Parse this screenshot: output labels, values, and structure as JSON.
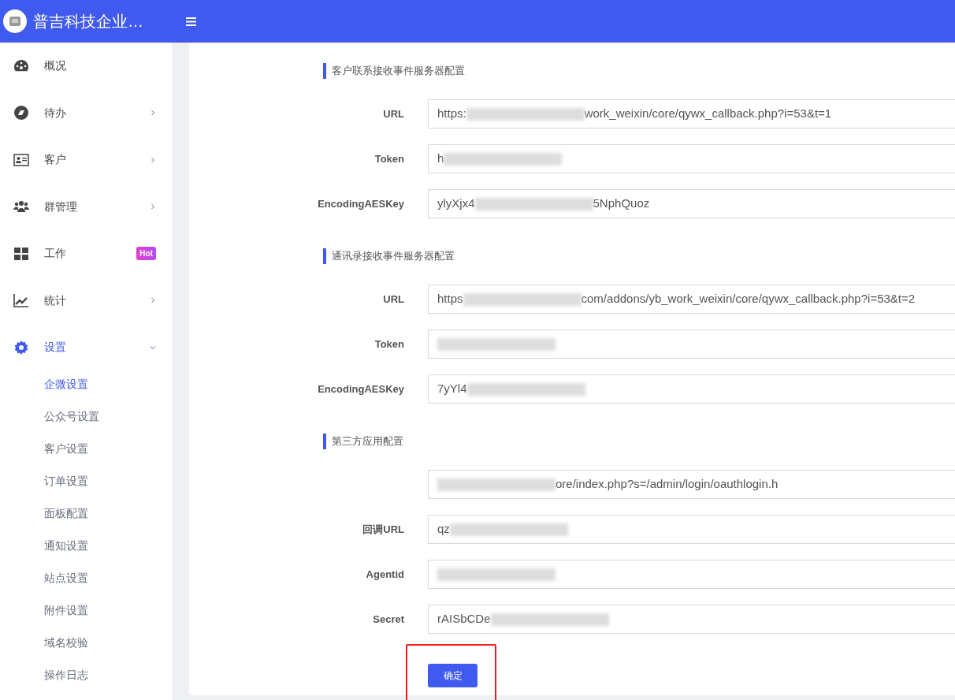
{
  "brand": {
    "title": "普吉科技企业…"
  },
  "menu": [
    {
      "label": "概况",
      "selected": false
    },
    {
      "label": "待办",
      "selected": false,
      "expanded": false
    },
    {
      "label": "客户",
      "selected": false,
      "expanded": false
    },
    {
      "label": "群管理",
      "selected": false,
      "expanded": false
    },
    {
      "label": "工作",
      "selected": false,
      "badge": "Hot"
    },
    {
      "label": "统计",
      "selected": false,
      "expanded": false
    },
    {
      "label": "设置",
      "selected": true,
      "expanded": true,
      "children": [
        {
          "label": "企微设置",
          "selected": true
        },
        {
          "label": "公众号设置",
          "selected": false
        },
        {
          "label": "客户设置",
          "selected": false
        },
        {
          "label": "订单设置",
          "selected": false
        },
        {
          "label": "面板配置",
          "selected": false
        },
        {
          "label": "通知设置",
          "selected": false
        },
        {
          "label": "站点设置",
          "selected": false
        },
        {
          "label": "附件设置",
          "selected": false
        },
        {
          "label": "域名校验",
          "selected": false
        },
        {
          "label": "操作日志",
          "selected": false
        }
      ]
    }
  ],
  "sections": [
    {
      "title": "客户联系接收事件服务器配置",
      "fields": [
        {
          "label": "URL",
          "parts": [
            {
              "kind": "text",
              "text": "https:"
            },
            {
              "kind": "blur"
            },
            {
              "kind": "text",
              "text": "work_weixin/core/qywx_callback.php?i=53&t=1"
            }
          ]
        },
        {
          "label": "Token",
          "parts": [
            {
              "kind": "text",
              "text": "h"
            },
            {
              "kind": "blur"
            }
          ]
        },
        {
          "label": "EncodingAESKey",
          "parts": [
            {
              "kind": "text",
              "text": "ylyXjx4"
            },
            {
              "kind": "blur"
            },
            {
              "kind": "text",
              "text": "5NphQuoz"
            }
          ]
        }
      ]
    },
    {
      "title": "通讯录接收事件服务器配置",
      "fields": [
        {
          "label": "URL",
          "parts": [
            {
              "kind": "text",
              "text": "https"
            },
            {
              "kind": "blur"
            },
            {
              "kind": "text",
              "text": "com/addons/yb_work_weixin/core/qywx_callback.php?i=53&t=2"
            }
          ]
        },
        {
          "label": "Token",
          "parts": [
            {
              "kind": "blur"
            }
          ]
        },
        {
          "label": "EncodingAESKey",
          "parts": [
            {
              "kind": "text",
              "text": "7yYl4"
            },
            {
              "kind": "blur"
            }
          ]
        }
      ]
    },
    {
      "title": "第三方应用配置",
      "fields": [
        {
          "parts": [
            {
              "kind": "blur"
            },
            {
              "kind": "text",
              "text": "ore/index.php?s=/admin/login/oauthlogin.h"
            }
          ]
        },
        {
          "label": "回调URL",
          "parts": [
            {
              "kind": "text",
              "text": "qz"
            },
            {
              "kind": "blur"
            }
          ]
        },
        {
          "label": "Agentid",
          "parts": [
            {
              "kind": "blur"
            }
          ]
        },
        {
          "label": "Secret",
          "parts": [
            {
              "kind": "text",
              "text": "rAISbCDe"
            },
            {
              "kind": "blur"
            }
          ]
        }
      ]
    }
  ],
  "submit": {
    "label": "确定",
    "highlighted": true
  }
}
